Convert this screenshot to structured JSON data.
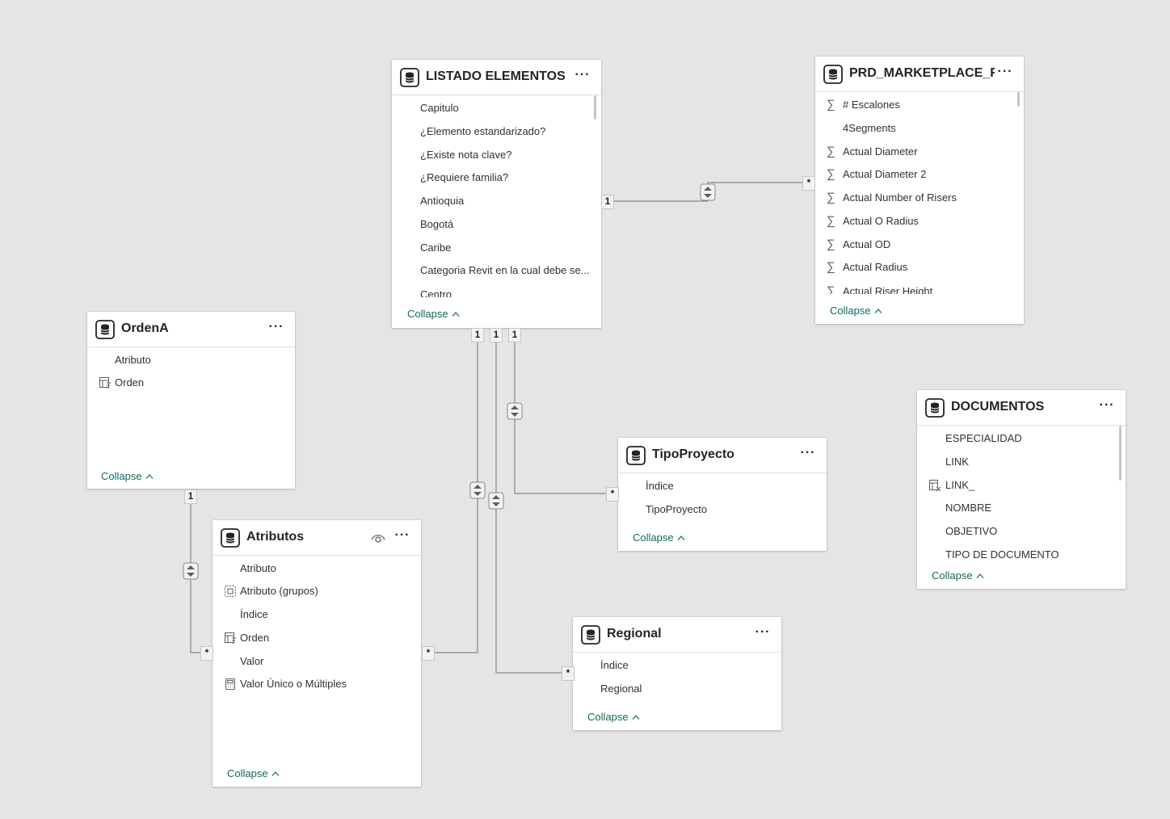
{
  "tables": {
    "listado": {
      "title": "LISTADO ELEMENTOS",
      "fields": [
        "Capitulo",
        "¿Elemento estandarizado?",
        "¿Existe nota clave?",
        "¿Requiere familia?",
        "Antioquia",
        "Bogotá",
        "Caribe",
        "Categoria Revit en la cual debe se...",
        "Centro"
      ],
      "collapse": "Collapse"
    },
    "prd": {
      "title": "PRD_MARKETPLACE_FA...",
      "fields": [
        {
          "label": "# Escalones",
          "icon": "sigma-icon"
        },
        {
          "label": "4Segments",
          "icon": ""
        },
        {
          "label": "Actual Diameter",
          "icon": "sigma-icon"
        },
        {
          "label": "Actual Diameter 2",
          "icon": "sigma-icon"
        },
        {
          "label": "Actual Number of Risers",
          "icon": "sigma-icon"
        },
        {
          "label": "Actual O Radius",
          "icon": "sigma-icon"
        },
        {
          "label": "Actual OD",
          "icon": "sigma-icon"
        },
        {
          "label": "Actual Radius",
          "icon": "sigma-icon"
        },
        {
          "label": "Actual Riser Height",
          "icon": "sigma-icon"
        }
      ],
      "collapse": "Collapse"
    },
    "ordena": {
      "title": "OrdenA",
      "fields": [
        {
          "label": "Atributo",
          "icon": ""
        },
        {
          "label": "Orden",
          "icon": "sort-by-column-icon"
        }
      ],
      "collapse": "Collapse"
    },
    "atributos": {
      "title": "Atributos",
      "fields": [
        {
          "label": "Atributo",
          "icon": ""
        },
        {
          "label": "Atributo (grupos)",
          "icon": "group-icon"
        },
        {
          "label": "Índice",
          "icon": ""
        },
        {
          "label": "Orden",
          "icon": "sort-by-column-icon"
        },
        {
          "label": "Valor",
          "icon": ""
        },
        {
          "label": "Valor Único o Múltiples",
          "icon": "calculator-icon"
        }
      ],
      "collapse": "Collapse"
    },
    "tipoproyecto": {
      "title": "TipoProyecto",
      "fields": [
        "Índice",
        "TipoProyecto"
      ],
      "collapse": "Collapse"
    },
    "regional": {
      "title": "Regional",
      "fields": [
        "Índice",
        "Regional"
      ],
      "collapse": "Collapse"
    },
    "documentos": {
      "title": "DOCUMENTOS",
      "fields": [
        {
          "label": "ESPECIALIDAD",
          "icon": ""
        },
        {
          "label": "LINK",
          "icon": ""
        },
        {
          "label": "LINK_",
          "icon": "calculated-column-icon"
        },
        {
          "label": "NOMBRE",
          "icon": ""
        },
        {
          "label": "OBJETIVO",
          "icon": ""
        },
        {
          "label": "TIPO DE DOCUMENTO",
          "icon": ""
        }
      ],
      "collapse": "Collapse"
    }
  },
  "cardinality": {
    "one": "1",
    "many": "*"
  },
  "colors": {
    "canvas": "#e6e5e3",
    "card": "#ffffff",
    "link_line": "#8a8886",
    "collapse_text": "#0e6b5c"
  }
}
